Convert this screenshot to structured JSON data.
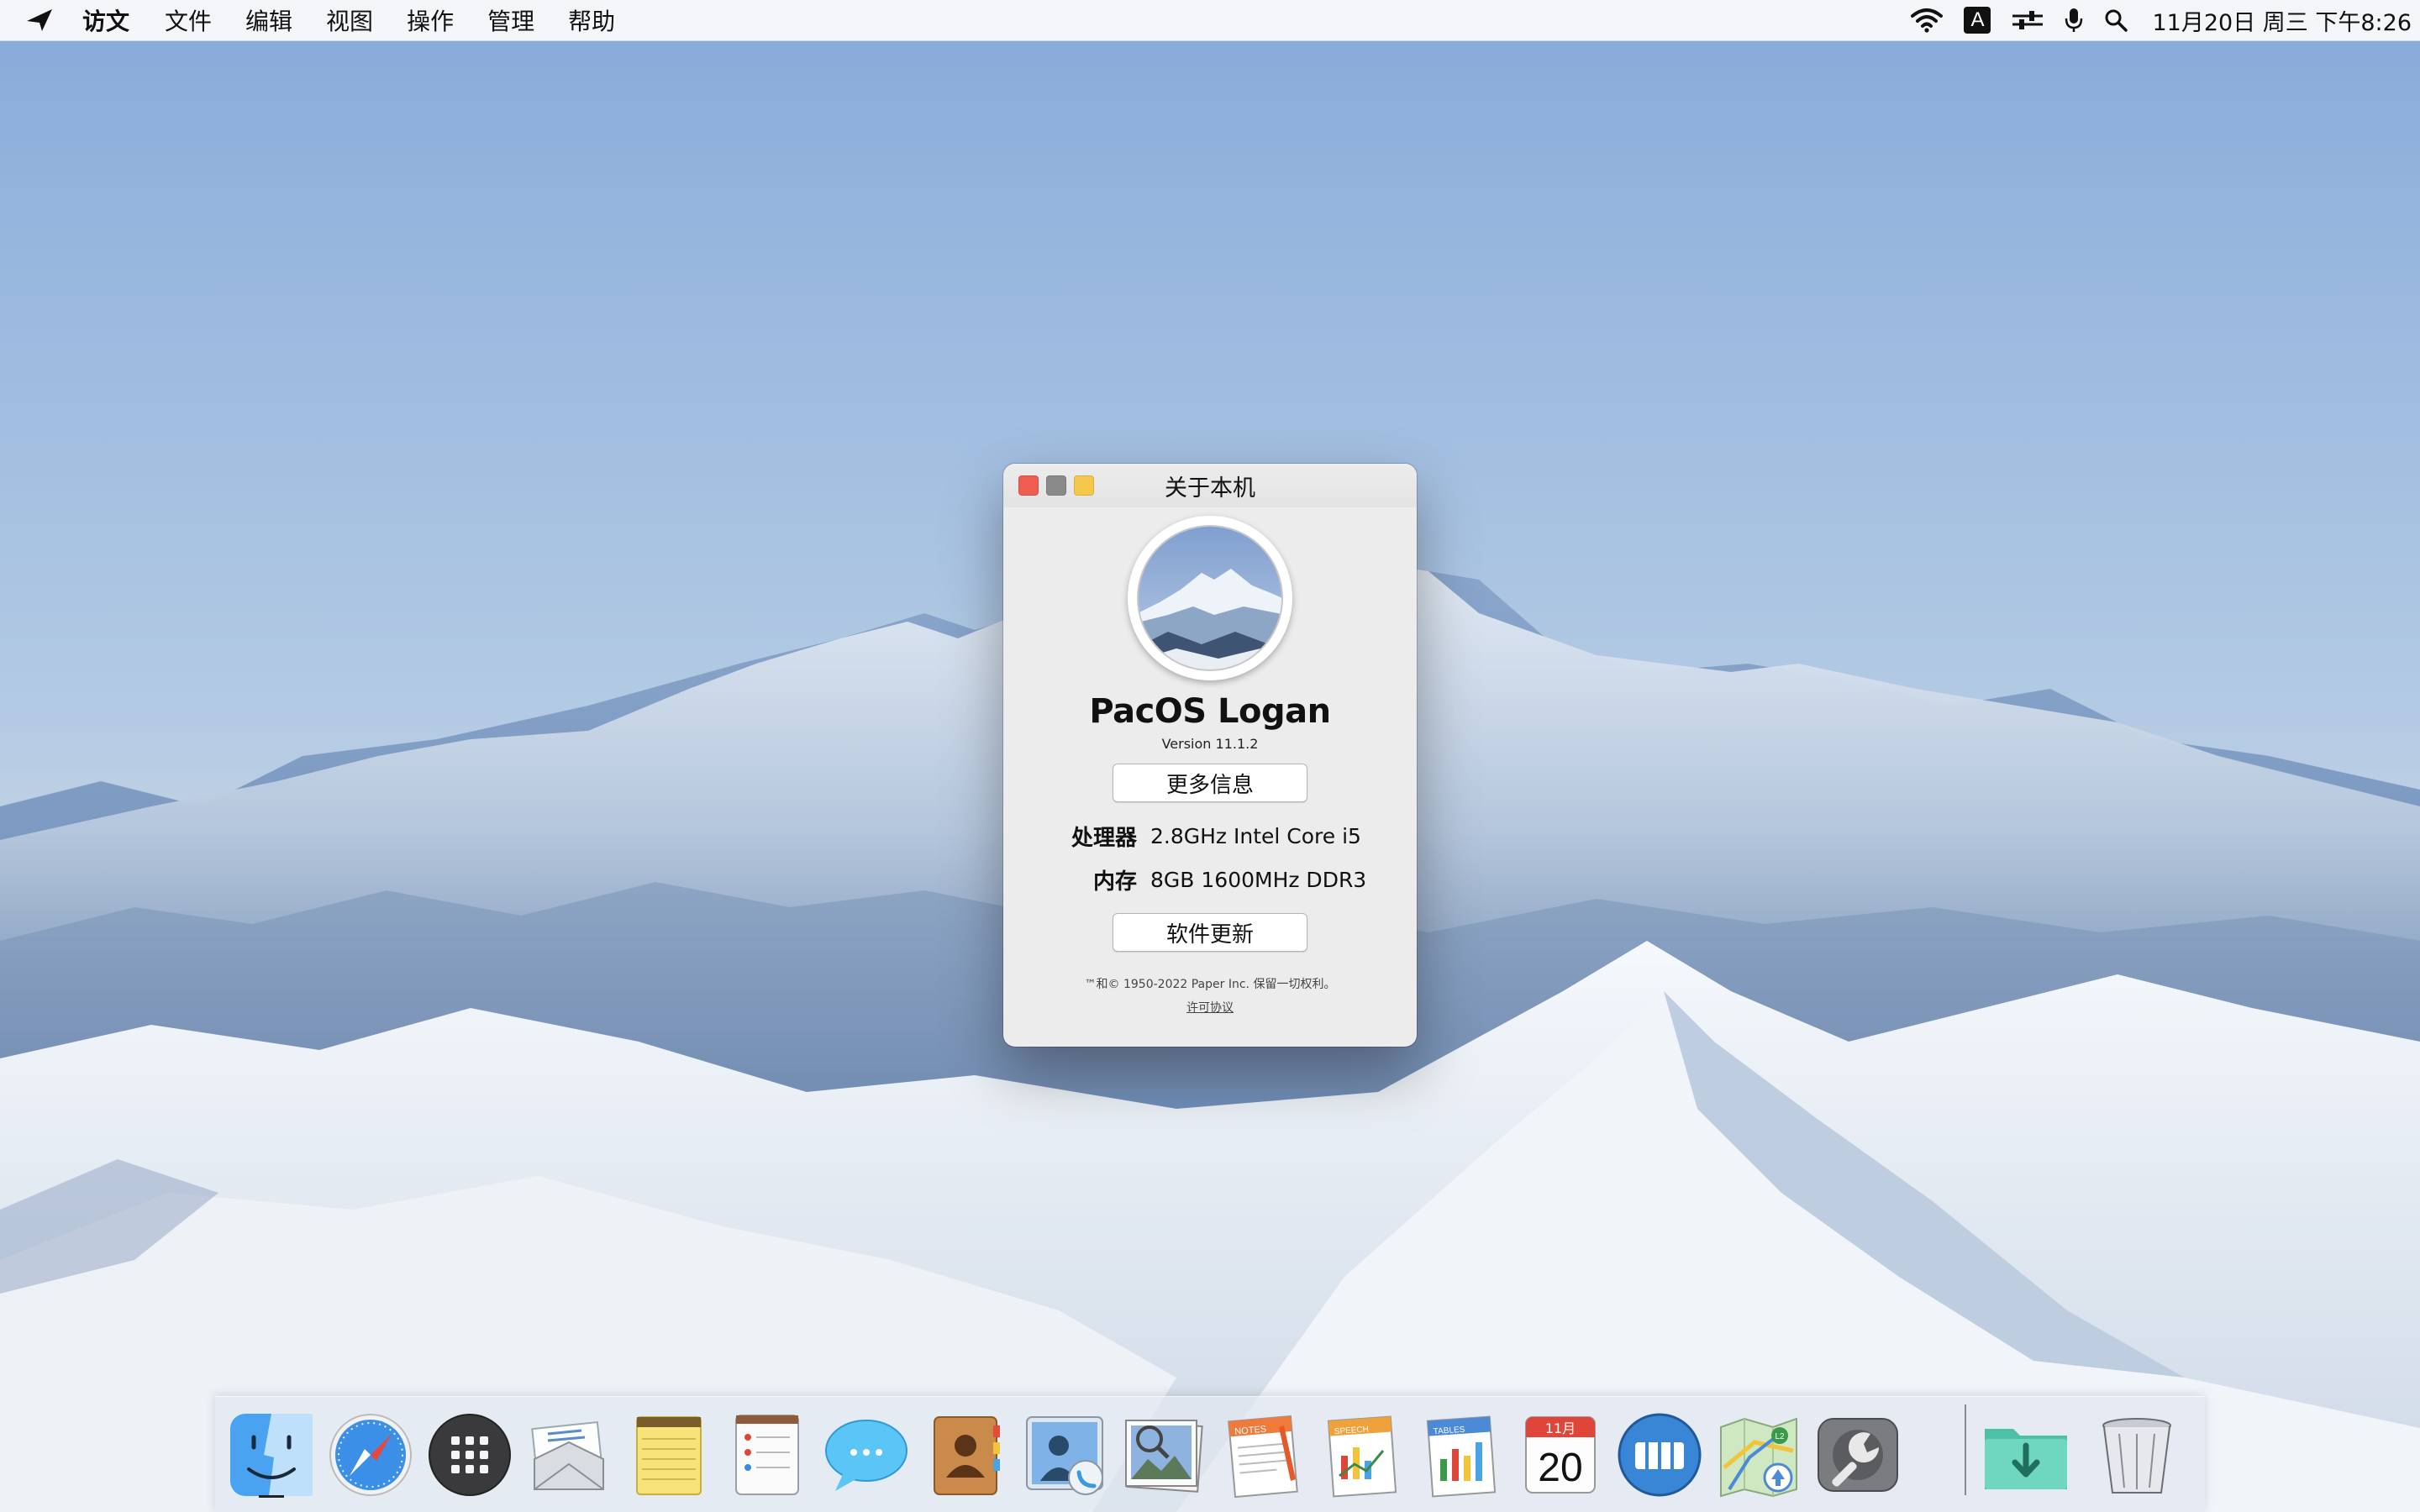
{
  "menubar": {
    "app_name": "访文",
    "items": [
      "文件",
      "编辑",
      "视图",
      "操作",
      "管理",
      "帮助"
    ],
    "clock": "11月20日 周三 下午8:26",
    "status_icons": [
      "wifi-icon",
      "input-method-icon",
      "control-center-icon",
      "microphone-icon",
      "search-icon"
    ],
    "input_method_label": "A"
  },
  "about_window": {
    "title": "关于本机",
    "os_name": "PacOS Logan",
    "version": "Version 11.1.2",
    "more_info_button": "更多信息",
    "specs": [
      {
        "key": "处理器",
        "value": "2.8GHz Intel Core i5"
      },
      {
        "key": "内存",
        "value": "8GB 1600MHz DDR3"
      }
    ],
    "software_update_button": "软件更新",
    "legal": "™和© 1950-2022 Paper Inc. 保留一切权利。",
    "license_link": "许可协议"
  },
  "dock": {
    "items": [
      "finder-icon",
      "safari-icon",
      "launchpad-icon",
      "mail-icon",
      "notes-icon",
      "reminders-icon",
      "messages-icon",
      "contacts-icon",
      "facetime-icon",
      "preview-icon",
      "pages-icon",
      "keynote-icon",
      "numbers-icon",
      "calendar-icon",
      "photo-booth-icon",
      "maps-icon",
      "system-preferences-icon",
      "downloads-folder-icon",
      "trash-icon"
    ],
    "calendar_month": "11月",
    "calendar_day": "20",
    "pages_label": "NOTES",
    "keynote_label": "SPEECH",
    "numbers_label": "TABLES",
    "maps_badge": "L2"
  },
  "colors": {
    "close": "#ee5d50",
    "minimize": "#8a8a8a",
    "maximize": "#f5c84c",
    "sky_top": "#87a9d9",
    "snow": "#eef2f7"
  }
}
